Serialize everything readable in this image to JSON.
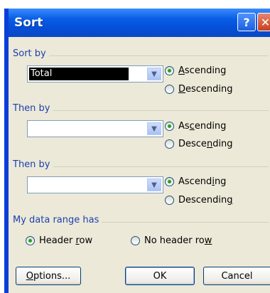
{
  "window": {
    "title": "Sort",
    "help_label": "?",
    "close_label": "✕"
  },
  "sort_by": {
    "group_label": "Sort by",
    "value": "Total",
    "ascending": {
      "pre": "",
      "ul": "A",
      "post": "scending"
    },
    "descending": {
      "pre": "",
      "ul": "D",
      "post": "escending"
    },
    "selected": "ascending"
  },
  "then_by_1": {
    "group_label": "Then by",
    "value": "",
    "ascending": {
      "pre": "As",
      "ul": "c",
      "post": "ending"
    },
    "descending": {
      "pre": "Desce",
      "ul": "n",
      "post": "ding"
    },
    "selected": "ascending"
  },
  "then_by_2": {
    "group_label": "Then by",
    "value": "",
    "ascending": {
      "pre": "Ascend",
      "ul": "i",
      "post": "ng"
    },
    "descending": {
      "pre": "Descendin",
      "ul": "g",
      "post": ""
    },
    "selected": "ascending"
  },
  "data_range": {
    "group_label": "My data range has",
    "header_row": {
      "pre": "Header ",
      "ul": "r",
      "post": "ow"
    },
    "no_header_row": {
      "pre": "No header ro",
      "ul": "w",
      "post": ""
    },
    "selected": "header_row"
  },
  "buttons": {
    "options": {
      "pre": "",
      "ul": "O",
      "post": "ptions..."
    },
    "ok": "OK",
    "cancel": "Cancel"
  }
}
